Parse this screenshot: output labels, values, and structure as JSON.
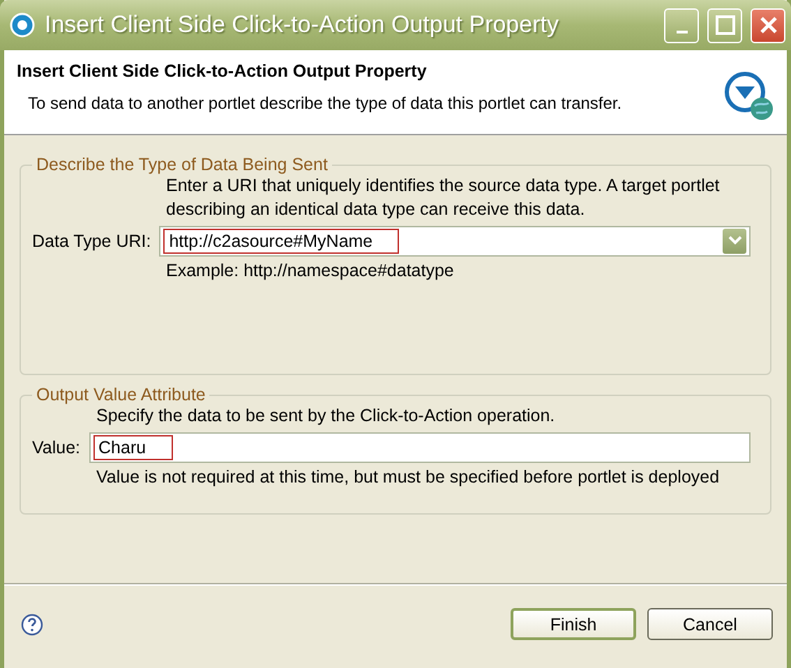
{
  "window": {
    "title": "Insert Client Side Click-to-Action Output Property"
  },
  "header": {
    "title": "Insert Client Side Click-to-Action Output Property",
    "description": "To send data to another portlet describe the type of data this portlet can transfer."
  },
  "groups": [
    {
      "title": "Describe the Type of Data Being Sent",
      "intro": "Enter a URI that uniquely identifies the source data type. A target portlet describing an identical data type can receive this data.",
      "label": "Data Type URI:",
      "value": "http://c2asource#MyName",
      "highlighted": true,
      "kind": "combo",
      "hint": "Example: http://namespace#datatype"
    },
    {
      "title": "Output Value Attribute",
      "intro": "Specify the data to be sent by the Click-to-Action operation.",
      "label": "Value:",
      "value": "Charu",
      "highlighted": true,
      "kind": "text",
      "hint": "Value is not required at this time, but must be specified before portlet is deployed"
    }
  ],
  "buttons": [
    {
      "label": "Finish",
      "default": true
    },
    {
      "label": "Cancel",
      "default": false
    }
  ]
}
